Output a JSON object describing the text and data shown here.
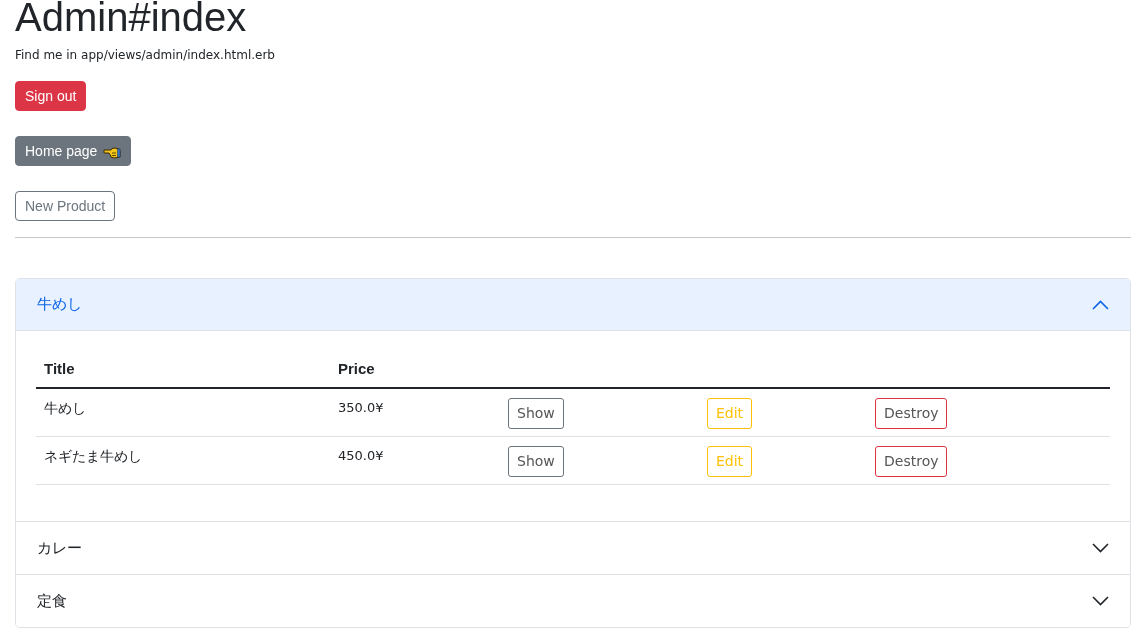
{
  "page": {
    "title": "Admin#index",
    "note": "Find me in app/views/admin/index.html.erb"
  },
  "buttons": [
    {
      "label": "Sign out",
      "kind": "danger",
      "has_icon": false
    },
    {
      "label": "Home page",
      "kind": "secondary",
      "has_icon": true
    },
    {
      "label": "New Product",
      "kind": "outline",
      "has_icon": false
    }
  ],
  "categories": [
    {
      "title": "牛めし",
      "expanded": true,
      "table": {
        "columns": [
          "Title",
          "Price"
        ],
        "rows": [
          {
            "title": "牛めし",
            "price": "350.0¥",
            "actions": [
              {
                "label": "Show",
                "kind": "show"
              },
              {
                "label": "Edit",
                "kind": "edit"
              },
              {
                "label": "Destroy",
                "kind": "destroy"
              }
            ]
          },
          {
            "title": "ネギたま牛めし",
            "price": "450.0¥",
            "actions": [
              {
                "label": "Show",
                "kind": "show"
              },
              {
                "label": "Edit",
                "kind": "edit"
              },
              {
                "label": "Destroy",
                "kind": "destroy"
              }
            ]
          }
        ]
      }
    },
    {
      "title": "カレー",
      "expanded": false
    },
    {
      "title": "定食",
      "expanded": false
    }
  ]
}
